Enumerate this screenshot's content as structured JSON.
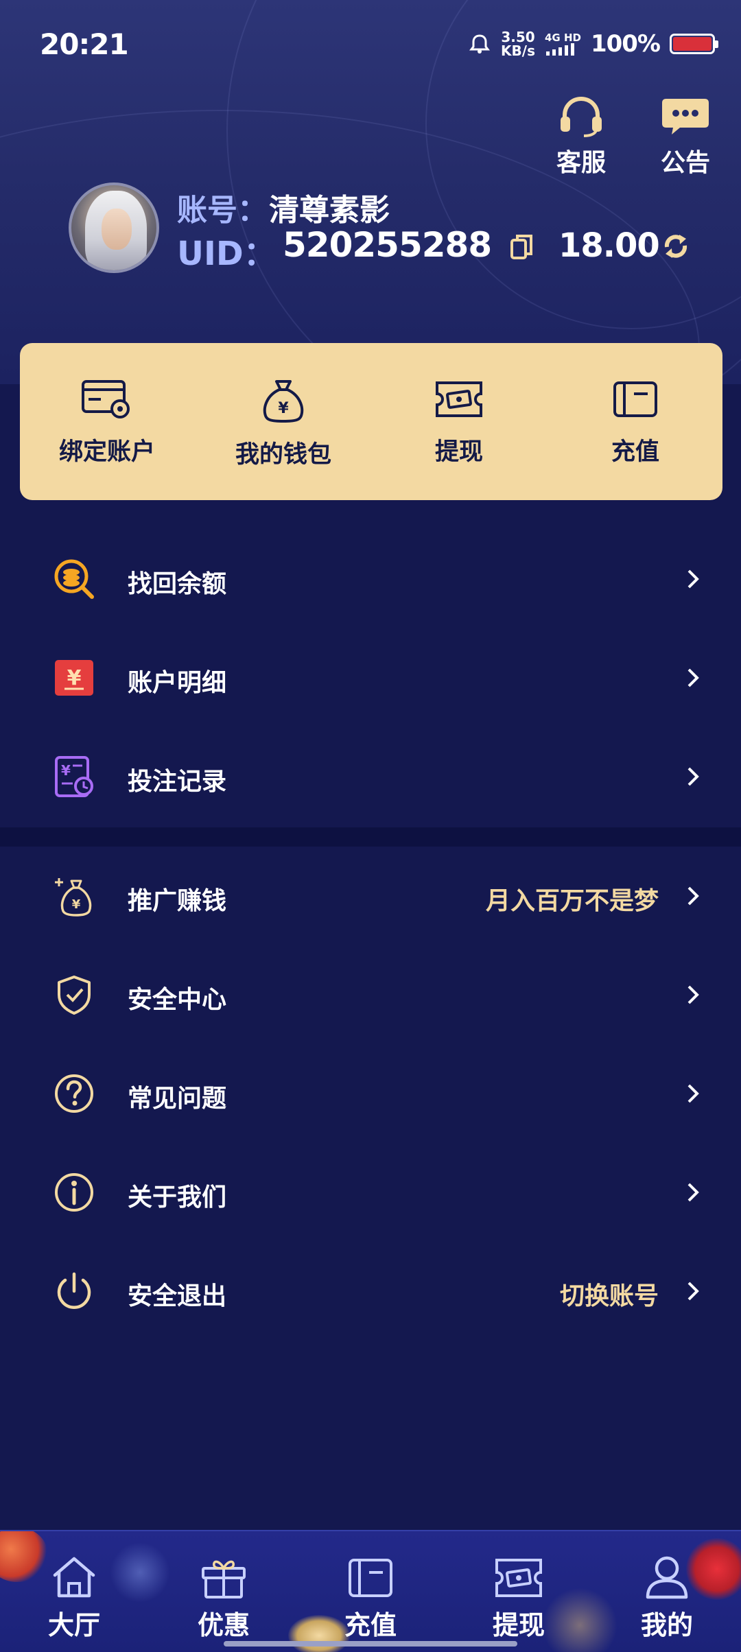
{
  "status_bar": {
    "time": "20:21",
    "net_speed_value": "3.50",
    "net_speed_unit": "KB/s",
    "signal_label": "4G HD",
    "battery_percent": "100%"
  },
  "header": {
    "actions": [
      {
        "label": "客服",
        "icon": "headset-icon"
      },
      {
        "label": "公告",
        "icon": "chat-bubble-icon"
      }
    ],
    "account_label": "账号：",
    "account_name": "清尊素影",
    "uid_label": "UID：",
    "uid_value": "520255288",
    "balance": "18.00"
  },
  "wallet_card": {
    "items": [
      {
        "label": "绑定账户",
        "icon": "card-settings-icon"
      },
      {
        "label": "我的钱包",
        "icon": "money-bag-icon"
      },
      {
        "label": "提现",
        "icon": "ticket-cash-icon"
      },
      {
        "label": "充值",
        "icon": "wallet-icon"
      }
    ]
  },
  "menu": {
    "group1": [
      {
        "label": "找回余额",
        "icon": "coin-search-icon",
        "hint": ""
      },
      {
        "label": "账户明细",
        "icon": "yuan-note-icon",
        "hint": ""
      },
      {
        "label": "投注记录",
        "icon": "bet-record-icon",
        "hint": ""
      }
    ],
    "group2": [
      {
        "label": "推广赚钱",
        "icon": "money-bag-plus-icon",
        "hint": "月入百万不是梦"
      },
      {
        "label": "安全中心",
        "icon": "shield-check-icon",
        "hint": ""
      },
      {
        "label": "常见问题",
        "icon": "question-icon",
        "hint": ""
      },
      {
        "label": "关于我们",
        "icon": "info-icon",
        "hint": ""
      },
      {
        "label": "安全退出",
        "icon": "power-icon",
        "hint": "切换账号"
      }
    ]
  },
  "bottom_nav": {
    "items": [
      {
        "label": "大厅",
        "icon": "home-icon"
      },
      {
        "label": "优惠",
        "icon": "gift-icon"
      },
      {
        "label": "充值",
        "icon": "wallet-icon"
      },
      {
        "label": "提现",
        "icon": "ticket-cash-icon"
      },
      {
        "label": "我的",
        "icon": "user-icon"
      }
    ]
  },
  "colors": {
    "background": "#14184f",
    "header_top": "#2d3577",
    "card": "#f3d9a2",
    "accent_gold": "#f3d9a2",
    "label_blue": "#a7b7ff",
    "nav_bg": "#1f2680"
  }
}
